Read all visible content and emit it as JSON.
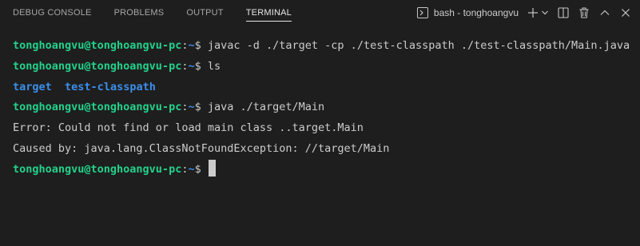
{
  "tabs": [
    {
      "label": "DEBUG CONSOLE",
      "active": false
    },
    {
      "label": "PROBLEMS",
      "active": false
    },
    {
      "label": "OUTPUT",
      "active": false
    },
    {
      "label": "TERMINAL",
      "active": true
    }
  ],
  "toolbar": {
    "terminal_name": "bash - tonghoangvu",
    "terminal_icon": "terminal-icon",
    "add_icon": "plus-icon",
    "dropdown_icon": "chevron-down-icon",
    "split_icon": "split-icon",
    "trash_icon": "trash-icon",
    "maximize_icon": "chevron-up-icon",
    "close_icon": "close-icon"
  },
  "terminal": {
    "prompt_user": "tonghoangvu@tonghoangvu-pc",
    "prompt_colon": ":",
    "prompt_path": "~",
    "prompt_symbol": "$",
    "lines": [
      {
        "type": "prompt",
        "command": " javac -d ./target -cp ./test-classpath ./test-classpath/Main.java"
      },
      {
        "type": "prompt",
        "command": " ls"
      },
      {
        "type": "dirs",
        "items": [
          "target",
          "test-classpath"
        ]
      },
      {
        "type": "prompt",
        "command": " java ./target/Main"
      },
      {
        "type": "output",
        "text": "Error: Could not find or load main class ..target.Main"
      },
      {
        "type": "output",
        "text": "Caused by: java.lang.ClassNotFoundException: //target/Main"
      },
      {
        "type": "prompt",
        "command": " "
      }
    ]
  },
  "colors": {
    "background": "#1e1e1e",
    "prompt_user": "#23d18b",
    "prompt_path": "#3b8eea",
    "text": "#cccccc"
  }
}
